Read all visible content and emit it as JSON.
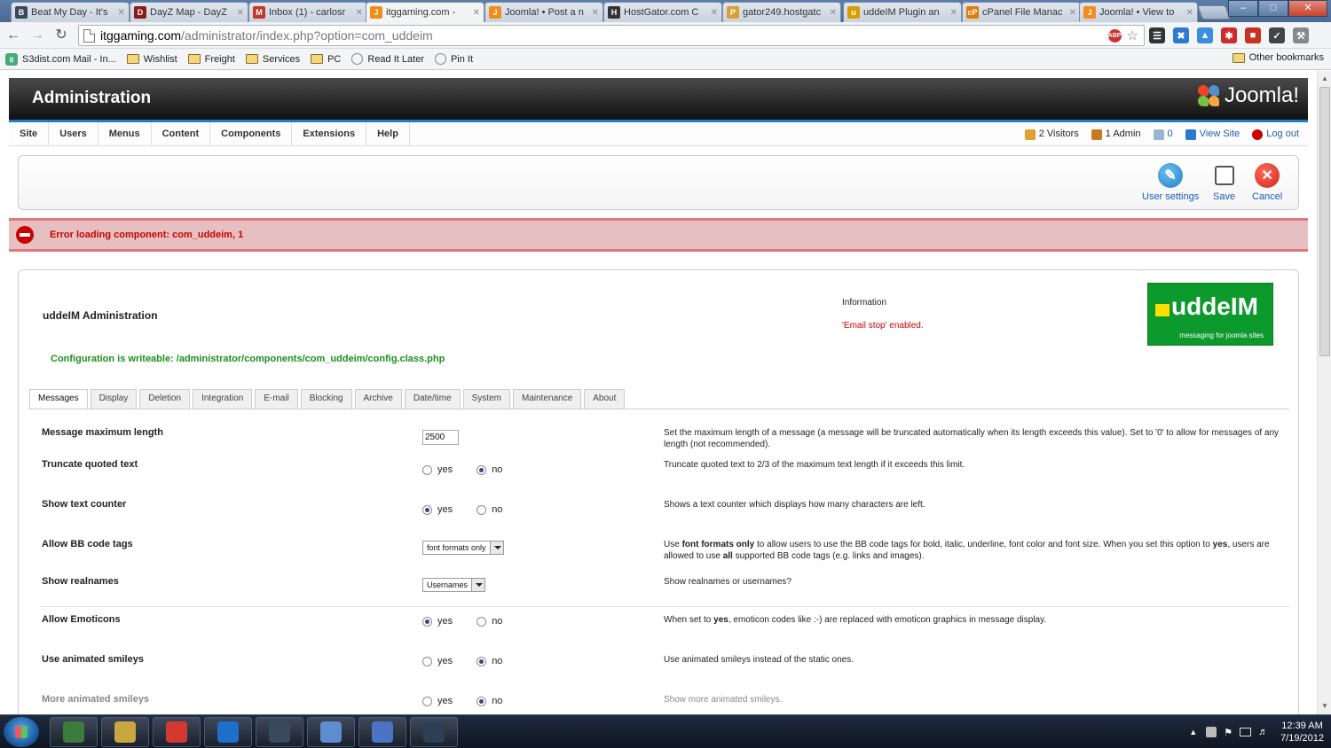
{
  "browser": {
    "tabs": [
      {
        "title": "Beat My Day - It's",
        "fav_color": "#3a4a5a",
        "fav_glyph": "B"
      },
      {
        "title": "DayZ Map - DayZ",
        "fav_color": "#8b1a1a",
        "fav_glyph": "D"
      },
      {
        "title": "Inbox (1) - carlosr",
        "fav_color": "#c0392b",
        "fav_glyph": "M"
      },
      {
        "title": "itggaming.com -",
        "fav_color": "#f28c1b",
        "fav_glyph": "J"
      },
      {
        "title": "Joomla! • Post a n",
        "fav_color": "#f28c1b",
        "fav_glyph": "J"
      },
      {
        "title": "HostGator.com C",
        "fav_color": "#333333",
        "fav_glyph": "H"
      },
      {
        "title": "gator249.hostgatc",
        "fav_color": "#d8a030",
        "fav_glyph": "P"
      },
      {
        "title": "uddeIM Plugin an",
        "fav_color": "#d4a000",
        "fav_glyph": "u"
      },
      {
        "title": "cPanel File Manac",
        "fav_color": "#e07b00",
        "fav_glyph": "cP"
      },
      {
        "title": "Joomla! • View to",
        "fav_color": "#f28c1b",
        "fav_glyph": "J"
      }
    ],
    "active_tab": 3,
    "url_host": "itggaming.com",
    "url_path": "/administrator/index.php?option=com_uddeim",
    "bookmarks": [
      "S3dist.com Mail - In...",
      "Wishlist",
      "Freight",
      "Services",
      "PC",
      "Read It Later",
      "Pin It"
    ],
    "other_bookmarks": "Other bookmarks"
  },
  "admin": {
    "title": "Administration",
    "logo_text": "Joomla!",
    "menu": [
      "Site",
      "Users",
      "Menus",
      "Content",
      "Components",
      "Extensions",
      "Help"
    ],
    "status": {
      "visitors": "2 Visitors",
      "admins": "1 Admin",
      "messages": "0",
      "view_site": "View Site",
      "logout": "Log out"
    },
    "toolbar": {
      "user_settings": "User settings",
      "save": "Save",
      "cancel": "Cancel"
    },
    "error": "Error loading component: com_uddeim, 1"
  },
  "component": {
    "title": "uddeIM Administration",
    "info_heading": "Information",
    "info_text": "'Email stop' enabled.",
    "logo_main": "uddeIM",
    "logo_tagline": "messaging for joomla sites",
    "config_msg": "Configuration is writeable: /administrator/components/com_uddeim/config.class.php",
    "tabs": [
      "Messages",
      "Display",
      "Deletion",
      "Integration",
      "E-mail",
      "Blocking",
      "Archive",
      "Date/time",
      "System",
      "Maintenance",
      "About"
    ],
    "active_tab": 0,
    "yes": "yes",
    "no": "no",
    "settings": [
      {
        "label": "Message maximum length",
        "value": "2500",
        "desc": "Set the maximum length of a message (a message will be truncated automatically when its length exceeds this value). Set to '0' to allow for messages of any length (not recommended)."
      },
      {
        "label": "Truncate quoted text",
        "selected": "no",
        "desc": "Truncate quoted text to 2/3 of the maximum text length if it exceeds this limit."
      },
      {
        "label": "Show text counter",
        "selected": "yes",
        "desc": "Shows a text counter which displays how many characters are left."
      },
      {
        "label": "Allow BB code tags",
        "value": "font formats only",
        "desc_parts": [
          "Use ",
          "font formats only",
          " to allow users to use the BB code tags for bold, italic, underline, font color and font size. When you set this option to ",
          "yes",
          ", users are allowed to use ",
          "all",
          " supported BB code tags (e.g. links and images)."
        ]
      },
      {
        "label": "Show realnames",
        "value": "Usernames",
        "desc": "Show realnames or usernames?"
      },
      {
        "label": "Allow Emoticons",
        "selected": "yes",
        "desc_parts": [
          "When set to ",
          "yes",
          ", emoticon codes like :-) are replaced with emoticon graphics in message display."
        ]
      },
      {
        "label": "Use animated smileys",
        "selected": "no",
        "desc": "Use animated smileys instead of the static ones."
      },
      {
        "label": "More animated smileys",
        "selected": "no",
        "desc": "Show more animated smileys."
      }
    ]
  },
  "taskbar": {
    "time": "12:39 AM",
    "date": "7/19/2012",
    "apps": [
      {
        "name": "Windows Explorer",
        "color": "#c9a640"
      },
      {
        "name": "Google Chrome",
        "color": "#d23a2f"
      },
      {
        "name": "TeamViewer",
        "color": "#1e6fc9"
      },
      {
        "name": "Steam",
        "color": "#3a4a5c"
      },
      {
        "name": "Notepad",
        "color": "#5d8ccf"
      },
      {
        "name": "Rocket",
        "color": "#4a73c4"
      },
      {
        "name": "Media",
        "color": "#2f3e52"
      }
    ]
  }
}
